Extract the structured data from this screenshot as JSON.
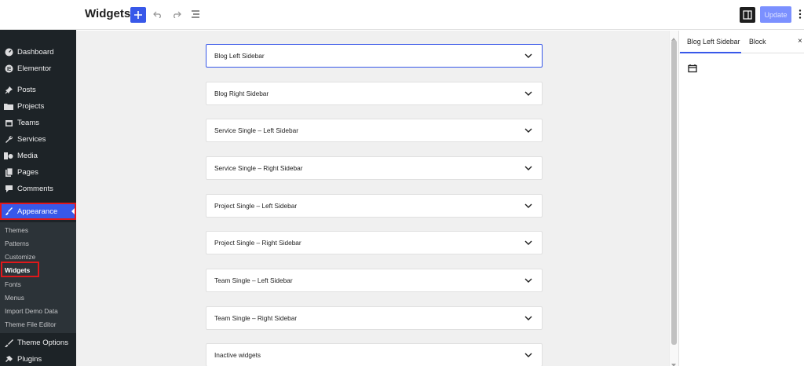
{
  "header": {
    "title": "Widgets",
    "update_label": "Update"
  },
  "admin_menu": {
    "items": [
      {
        "label": "Dashboard",
        "icon": "dashboard-icon"
      },
      {
        "label": "Elementor",
        "icon": "elementor-icon"
      },
      {
        "label": "Posts",
        "icon": "pin-icon"
      },
      {
        "label": "Projects",
        "icon": "folder-icon"
      },
      {
        "label": "Teams",
        "icon": "calendar-icon"
      },
      {
        "label": "Services",
        "icon": "wrench-icon"
      },
      {
        "label": "Media",
        "icon": "media-icon"
      },
      {
        "label": "Pages",
        "icon": "pages-icon"
      },
      {
        "label": "Comments",
        "icon": "comment-icon"
      },
      {
        "label": "Appearance",
        "icon": "paintbrush-icon"
      },
      {
        "label": "Theme Options",
        "icon": "brush-icon"
      },
      {
        "label": "Plugins",
        "icon": "plugin-icon"
      }
    ],
    "submenu": [
      "Themes",
      "Patterns",
      "Customize",
      "Widgets",
      "Fonts",
      "Menus",
      "Import Demo Data",
      "Theme File Editor"
    ]
  },
  "widget_areas": [
    "Blog Left Sidebar",
    "Blog Right Sidebar",
    "Service Single – Left Sidebar",
    "Service Single – Right Sidebar",
    "Project Single – Left Sidebar",
    "Project Single – Right Sidebar",
    "Team Single – Left Sidebar",
    "Team Single – Right Sidebar",
    "Inactive widgets"
  ],
  "inspector": {
    "tab_area": "Blog Left Sidebar",
    "tab_block": "Block",
    "close": "×"
  },
  "colors": {
    "accent": "#3858e9",
    "admin_bg": "#1d2327",
    "highlight_box": "#e0181b"
  }
}
